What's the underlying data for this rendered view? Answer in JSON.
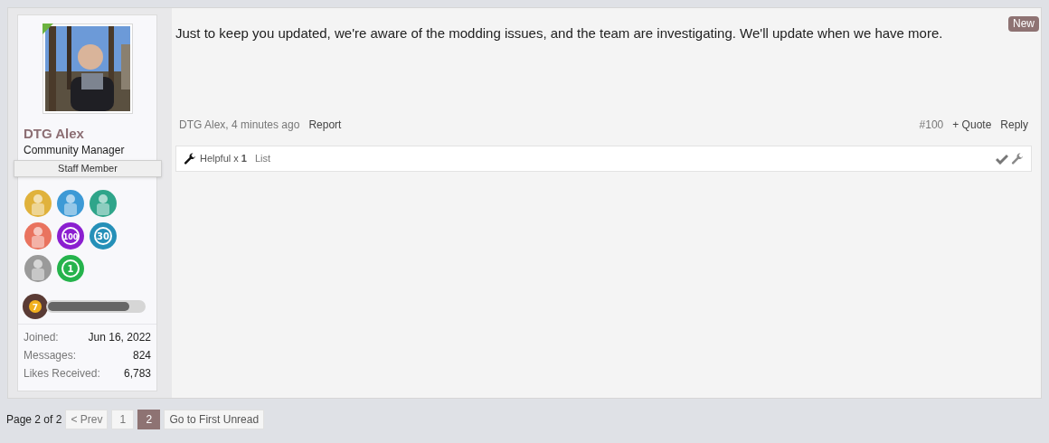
{
  "post": {
    "user": {
      "name": "DTG Alex",
      "title": "Community Manager",
      "banner": "Staff Member",
      "online": true,
      "trophies": [
        {
          "color": "#e0b23c"
        },
        {
          "color": "#3d9ad6"
        },
        {
          "color": "#2fa58a"
        },
        {
          "color": "#e9735f"
        },
        {
          "color": "#8b1fd0",
          "label": "100"
        },
        {
          "color": "#2590b8",
          "label": "30"
        },
        {
          "color": "#9a9a9a"
        },
        {
          "color": "#25b34c",
          "label": "1"
        }
      ],
      "rank": {
        "label": "7",
        "level": 0.85
      },
      "stats": [
        {
          "label": "Joined:",
          "value": "Jun 16, 2022"
        },
        {
          "label": "Messages:",
          "value": "824"
        },
        {
          "label": "Likes Received:",
          "value": "6,783"
        }
      ]
    },
    "badge": "New",
    "message": "Just to keep you updated, we're aware of the modding issues, and the team are investigating. We'll update when we have more.",
    "meta": {
      "author_time": "DTG Alex, 4 minutes ago",
      "report": "Report",
      "number": "#100",
      "quote": "+ Quote",
      "reply": "Reply"
    },
    "likes": {
      "text": "Helpful x **1**",
      "list": "List"
    }
  },
  "pagination": {
    "label": "Page 2 of 2",
    "prev": "< Prev",
    "pages": [
      {
        "label": "1",
        "selected": false
      },
      {
        "label": "2",
        "selected": true
      }
    ],
    "first_unread": "Go to First Unread"
  }
}
